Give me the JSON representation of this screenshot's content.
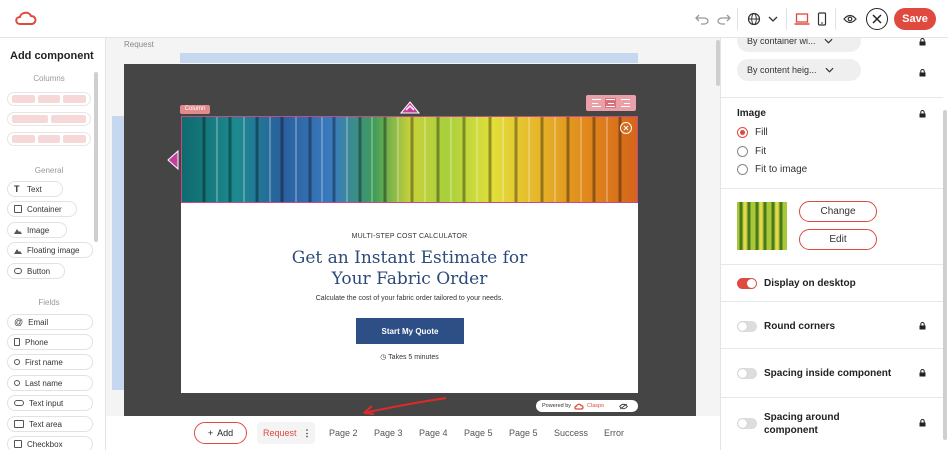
{
  "colors": {
    "accent": "#e0493e",
    "title_blue": "#2d4a78",
    "button_blue": "#2d4f86"
  },
  "toolbar": {
    "save_label": "Save"
  },
  "left_panel": {
    "title": "Add component",
    "sections": {
      "columns": "Columns",
      "general": "General",
      "fields": "Fields"
    },
    "general_items": [
      "Text",
      "Container",
      "Image",
      "Floating image",
      "Button"
    ],
    "field_items": [
      "Email",
      "Phone",
      "First name",
      "Last name",
      "Text input",
      "Text area",
      "Checkbox"
    ]
  },
  "canvas": {
    "page_label": "Request",
    "column_tag": "Column",
    "eyebrow": "MULTI-STEP COST CALCULATOR",
    "headline_1": "Get an Instant Estimate for",
    "headline_2": "Your Fabric Order",
    "subtitle": "Calculate the cost of your fabric order tailored to your needs.",
    "cta": "Start My Quote",
    "time_note": "Takes 5 minutes",
    "powered_by": "Powered by",
    "brand": "Claspo"
  },
  "bottom": {
    "add_label": "Add",
    "active_page": "Request",
    "pages": [
      "Page 2",
      "Page 3",
      "Page 4",
      "Page 5",
      "Page 5",
      "Success",
      "Error"
    ]
  },
  "right_panel": {
    "width_select": "By container wi...",
    "height_select": "By content heig...",
    "image_heading": "Image",
    "image_options": [
      "Fill",
      "Fit",
      "Fit to image"
    ],
    "image_selected": "Fill",
    "change_label": "Change",
    "edit_label": "Edit",
    "toggles": [
      {
        "label": "Display on desktop",
        "on": true
      },
      {
        "label": "Round corners",
        "on": false
      },
      {
        "label": "Spacing inside component",
        "on": false
      },
      {
        "label": "Spacing around component",
        "on": false
      }
    ]
  }
}
